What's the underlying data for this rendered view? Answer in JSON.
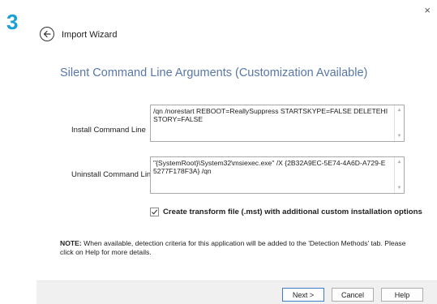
{
  "step_number": "3",
  "dialog": {
    "title": "Import Wizard",
    "close_glyph": "×",
    "back_icon": "arrow-left-icon"
  },
  "page": {
    "heading": "Silent Command Line Arguments (Customization Available)"
  },
  "install": {
    "label": "Install Command Line",
    "value": "/qn /norestart REBOOT=ReallySuppress STARTSKYPE=FALSE DELETEHISTORY=FALSE"
  },
  "uninstall": {
    "label": "Uninstall Command Line",
    "value": "\"{SystemRoot}\\System32\\msiexec.exe\" /X {2B32A9EC-5E74-4A6D-A729-E5277F178F3A} /qn"
  },
  "transform": {
    "checked": true,
    "label": "Create transform file (.mst) with additional custom installation options"
  },
  "note": {
    "prefix": "NOTE:",
    "text": " When available, detection criteria for this application will be added to the 'Detection Methods' tab. Please click on Help for more details."
  },
  "buttons": {
    "next": "Next >",
    "cancel": "Cancel",
    "help": "Help"
  },
  "colors": {
    "step_accent": "#1b9fd9",
    "heading": "#5877a8",
    "default_button_border": "#3d7cc9"
  }
}
